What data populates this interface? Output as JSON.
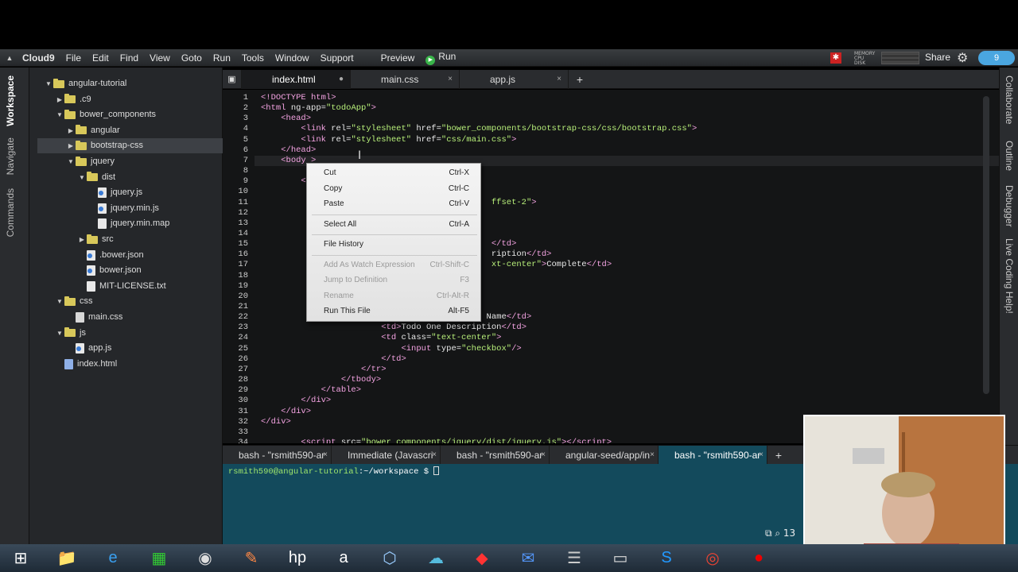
{
  "menu": {
    "brand": "Cloud9",
    "items": [
      "File",
      "Edit",
      "Find",
      "View",
      "Goto",
      "Run",
      "Tools",
      "Window",
      "Support"
    ],
    "preview": "Preview",
    "run": "Run",
    "share": "Share",
    "mem_labels": "MEMORY\nCPU\nDISK",
    "notify": "9"
  },
  "left_tabs": [
    "Workspace",
    "Navigate",
    "Commands"
  ],
  "tree": [
    {
      "label": "angular-tutorial",
      "type": "folder",
      "depth": 0,
      "open": true
    },
    {
      "label": ".c9",
      "type": "folder",
      "depth": 1,
      "open": false
    },
    {
      "label": "bower_components",
      "type": "folder",
      "depth": 1,
      "open": true
    },
    {
      "label": "angular",
      "type": "folder",
      "depth": 2,
      "open": false
    },
    {
      "label": "bootstrap-css",
      "type": "folder",
      "depth": 2,
      "open": false,
      "selected": true
    },
    {
      "label": "jquery",
      "type": "folder",
      "depth": 2,
      "open": true
    },
    {
      "label": "dist",
      "type": "folder",
      "depth": 3,
      "open": true
    },
    {
      "label": "jquery.js",
      "type": "js",
      "depth": 4
    },
    {
      "label": "jquery.min.js",
      "type": "js",
      "depth": 4
    },
    {
      "label": "jquery.min.map",
      "type": "file",
      "depth": 4
    },
    {
      "label": "src",
      "type": "folder",
      "depth": 3,
      "open": false
    },
    {
      "label": ".bower.json",
      "type": "js",
      "depth": 3
    },
    {
      "label": "bower.json",
      "type": "js",
      "depth": 3
    },
    {
      "label": "MIT-LICENSE.txt",
      "type": "file",
      "depth": 3
    },
    {
      "label": "css",
      "type": "folder",
      "depth": 1,
      "open": true
    },
    {
      "label": "main.css",
      "type": "css",
      "depth": 2
    },
    {
      "label": "js",
      "type": "folder",
      "depth": 1,
      "open": true
    },
    {
      "label": "app.js",
      "type": "js",
      "depth": 2
    },
    {
      "label": "index.html",
      "type": "html",
      "depth": 1
    }
  ],
  "editor_tabs": [
    {
      "label": "index.html",
      "active": true,
      "marker": "●"
    },
    {
      "label": "main.css",
      "active": false,
      "marker": "×"
    },
    {
      "label": "app.js",
      "active": false,
      "marker": "×"
    }
  ],
  "code": [
    {
      "n": "1",
      "html": "<span class='t'>&lt;!DOCTYPE html&gt;</span>"
    },
    {
      "n": "2",
      "html": "<span class='t'>&lt;html</span> ng-app=<span class='s'>\"todoApp\"</span><span class='t'>&gt;</span>"
    },
    {
      "n": "3",
      "html": "    <span class='t'>&lt;head&gt;</span>"
    },
    {
      "n": "4",
      "html": "        <span class='t'>&lt;link</span> rel=<span class='s'>\"stylesheet\"</span> href=<span class='s'>\"bower_components/bootstrap-css/css/bootstrap.css\"</span><span class='t'>&gt;</span>"
    },
    {
      "n": "5",
      "html": "        <span class='t'>&lt;link</span> rel=<span class='s'>\"stylesheet\"</span> href=<span class='s'>\"css/main.css\"</span><span class='t'>&gt;</span>"
    },
    {
      "n": "6",
      "html": "    <span class='t'>&lt;/head&gt;</span>"
    },
    {
      "n": "7",
      "html": "    <span class='t'>&lt;body &gt;</span>"
    },
    {
      "n": "8",
      "html": ""
    },
    {
      "n": "9",
      "html": "        <span class='t'>&lt;</span>"
    },
    {
      "n": "10",
      "html": ""
    },
    {
      "n": "11",
      "html": "                                              <span class='s'>ffset-2\"</span><span class='t'>&gt;</span>"
    },
    {
      "n": "12",
      "html": ""
    },
    {
      "n": "13",
      "html": ""
    },
    {
      "n": "14",
      "html": ""
    },
    {
      "n": "15",
      "html": "                                              <span class='t'>&lt;/td&gt;</span>"
    },
    {
      "n": "16",
      "html": "                                              ription<span class='t'>&lt;/td&gt;</span>"
    },
    {
      "n": "17",
      "html": "                                              <span class='s'>xt-center\"</span><span class='t'>&gt;</span>Complete<span class='t'>&lt;/td&gt;</span>"
    },
    {
      "n": "18",
      "html": ""
    },
    {
      "n": "19",
      "html": ""
    },
    {
      "n": "20",
      "html": ""
    },
    {
      "n": "21",
      "html": ""
    },
    {
      "n": "22",
      "html": "                                             Name<span class='t'>&lt;/td&gt;</span>"
    },
    {
      "n": "23",
      "html": "                        <span class='t'>&lt;td&gt;</span>Todo One Description<span class='t'>&lt;/td&gt;</span>"
    },
    {
      "n": "24",
      "html": "                        <span class='t'>&lt;td</span> class=<span class='s'>\"text-center\"</span><span class='t'>&gt;</span>"
    },
    {
      "n": "25",
      "html": "                            <span class='t'>&lt;input</span> type=<span class='s'>\"checkbox\"</span><span class='t'>/&gt;</span>"
    },
    {
      "n": "26",
      "html": "                        <span class='t'>&lt;/td&gt;</span>"
    },
    {
      "n": "27",
      "html": "                    <span class='t'>&lt;/tr&gt;</span>"
    },
    {
      "n": "28",
      "html": "                <span class='t'>&lt;/tbody&gt;</span>"
    },
    {
      "n": "29",
      "html": "            <span class='t'>&lt;/table&gt;</span>"
    },
    {
      "n": "30",
      "html": "        <span class='t'>&lt;/div&gt;</span>"
    },
    {
      "n": "31",
      "html": "    <span class='t'>&lt;/div&gt;</span>"
    },
    {
      "n": "32",
      "html": "<span class='t'>&lt;/div&gt;</span>"
    },
    {
      "n": "33",
      "html": ""
    },
    {
      "n": "34",
      "html": "        <span class='t'>&lt;script</span> src=<span class='s'>\"bower_components/jquery/dist/jquery.js\"</span><span class='t'>&gt;&lt;/script&gt;</span>"
    }
  ],
  "context_menu": [
    {
      "label": "Cut",
      "key": "Ctrl-X",
      "disabled": false
    },
    {
      "label": "Copy",
      "key": "Ctrl-C",
      "disabled": false
    },
    {
      "label": "Paste",
      "key": "Ctrl-V",
      "disabled": false
    },
    {
      "sep": true
    },
    {
      "label": "Select All",
      "key": "Ctrl-A",
      "disabled": false
    },
    {
      "sep": true
    },
    {
      "label": "File History",
      "key": "",
      "disabled": false
    },
    {
      "sep": true
    },
    {
      "label": "Add As Watch Expression",
      "key": "Ctrl-Shift-C",
      "disabled": true
    },
    {
      "label": "Jump to Definition",
      "key": "F3",
      "disabled": true
    },
    {
      "label": "Rename",
      "key": "Ctrl-Alt-R",
      "disabled": true
    },
    {
      "label": "Run This File",
      "key": "Alt-F5",
      "disabled": false
    }
  ],
  "terminal_tabs": [
    {
      "label": "bash - \"rsmith590-ar",
      "active": false
    },
    {
      "label": "Immediate (Javascri",
      "active": false
    },
    {
      "label": "bash - \"rsmith590-ar",
      "active": false
    },
    {
      "label": "angular-seed/app/in",
      "active": false
    },
    {
      "label": "bash - \"rsmith590-ar",
      "active": true
    }
  ],
  "terminal": {
    "user": "rsmith590@angular-tutorial",
    "path": ":~/workspace $ "
  },
  "right_tabs": [
    "Collaborate",
    "Outline",
    "Debugger",
    "Live Coding Help!"
  ],
  "taskbar": [
    "windows-start-icon",
    "file-explorer-icon",
    "internet-explorer-icon",
    "calculator-icon",
    "camera-icon",
    "paint-icon",
    "hp-icon",
    "amazon-icon",
    "box-icon",
    "cloud-icon",
    "git-icon",
    "thunderbird-icon",
    "database-icon",
    "command-prompt-icon",
    "skype-icon",
    "chrome-icon",
    "record-icon"
  ]
}
